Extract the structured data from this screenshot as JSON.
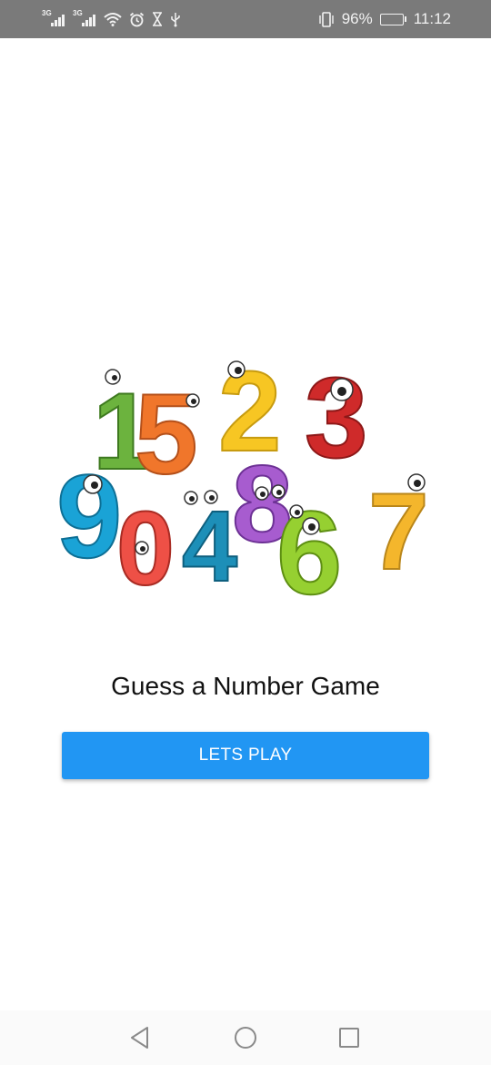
{
  "status_bar": {
    "network_1": "3G",
    "network_2": "3G",
    "battery_percent": "96%",
    "battery_level": 0.96,
    "time": "11:12",
    "icons": [
      "signal-icon",
      "signal-icon",
      "wifi-icon",
      "alarm-icon",
      "hourglass-icon",
      "usb-icon",
      "vibrate-icon",
      "battery-icon"
    ]
  },
  "main": {
    "illustration_icon": "cartoon-numbers-illustration",
    "illustration_digits": [
      "1",
      "5",
      "2",
      "3",
      "9",
      "0",
      "4",
      "8",
      "6",
      "7"
    ],
    "title": "Guess a Number Game",
    "play_label": "LETS PLAY",
    "accent_color": "#2196F3"
  },
  "nav_bar": {
    "icons": [
      "back-icon",
      "home-icon",
      "recents-icon"
    ]
  }
}
